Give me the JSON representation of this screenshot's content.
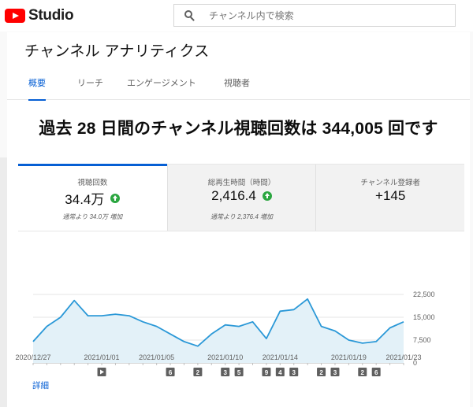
{
  "app": {
    "name": "Studio"
  },
  "search": {
    "placeholder": "チャンネル内で検索"
  },
  "page": {
    "title": "チャンネル アナリティクス"
  },
  "tabs": [
    {
      "label": "概要",
      "active": true
    },
    {
      "label": "リーチ",
      "active": false
    },
    {
      "label": "エンゲージメント",
      "active": false
    },
    {
      "label": "視聴者",
      "active": false
    }
  ],
  "headline": "過去 28 日間のチャンネル視聴回数は 344,005 回です",
  "metrics": [
    {
      "label": "視聴回数",
      "value": "34.4万",
      "trend": "up",
      "sub": "通常より 34.0万 増加",
      "selected": true
    },
    {
      "label": "総再生時間（時間）",
      "value": "2,416.4",
      "trend": "up",
      "sub": "通常より 2,376.4 増加",
      "selected": false
    },
    {
      "label": "チャンネル登録者",
      "value": "+145",
      "trend": "",
      "sub": "",
      "selected": false
    }
  ],
  "colors": {
    "accent": "#065fd4",
    "up": "#2ba640",
    "line": "#2a98d7",
    "fill": "#e3f1f8"
  },
  "chart_data": {
    "type": "area",
    "x": [
      "2020/12/27",
      "2020/12/28",
      "2020/12/29",
      "2020/12/30",
      "2020/12/31",
      "2021/01/01",
      "2021/01/02",
      "2021/01/03",
      "2021/01/04",
      "2021/01/05",
      "2021/01/06",
      "2021/01/07",
      "2021/01/08",
      "2021/01/09",
      "2021/01/10",
      "2021/01/11",
      "2021/01/12",
      "2021/01/13",
      "2021/01/14",
      "2021/01/15",
      "2021/01/16",
      "2021/01/17",
      "2021/01/18",
      "2021/01/19",
      "2021/01/20",
      "2021/01/21",
      "2021/01/22",
      "2021/01/23"
    ],
    "values": [
      7000,
      12000,
      15000,
      20500,
      15500,
      15500,
      16000,
      15500,
      13500,
      12000,
      9500,
      7000,
      5500,
      9500,
      12500,
      12000,
      13500,
      8000,
      17000,
      17500,
      21000,
      12000,
      10500,
      7500,
      6500,
      7000,
      11500,
      13500
    ],
    "yticks": [
      "22,500",
      "15,000",
      "7,500",
      "0"
    ],
    "ylim": [
      0,
      22500
    ],
    "xtick_labels": [
      {
        "date": "2020/12/27",
        "label": "2020/12/27"
      },
      {
        "date": "2021/01/01",
        "label": "2021/01/01"
      },
      {
        "date": "2021/01/05",
        "label": "2021/01/05"
      },
      {
        "date": "2021/01/10",
        "label": "2021/01/10"
      },
      {
        "date": "2021/01/14",
        "label": "2021/01/14"
      },
      {
        "date": "2021/01/19",
        "label": "2021/01/19"
      },
      {
        "date": "2021/01/23",
        "label": "2021/01/23"
      }
    ],
    "markers": [
      {
        "date": "2021/01/01",
        "label": "▶",
        "play": true
      },
      {
        "date": "2021/01/06",
        "label": "6"
      },
      {
        "date": "2021/01/08",
        "label": "2"
      },
      {
        "date": "2021/01/10",
        "label": "3"
      },
      {
        "date": "2021/01/11",
        "label": "5"
      },
      {
        "date": "2021/01/13",
        "label": "9"
      },
      {
        "date": "2021/01/14",
        "label": "4"
      },
      {
        "date": "2021/01/15",
        "label": "3"
      },
      {
        "date": "2021/01/17",
        "label": "2"
      },
      {
        "date": "2021/01/18",
        "label": "3"
      },
      {
        "date": "2021/01/20",
        "label": "2"
      },
      {
        "date": "2021/01/21",
        "label": "6"
      }
    ],
    "grid": true
  },
  "detail_link": "詳細"
}
